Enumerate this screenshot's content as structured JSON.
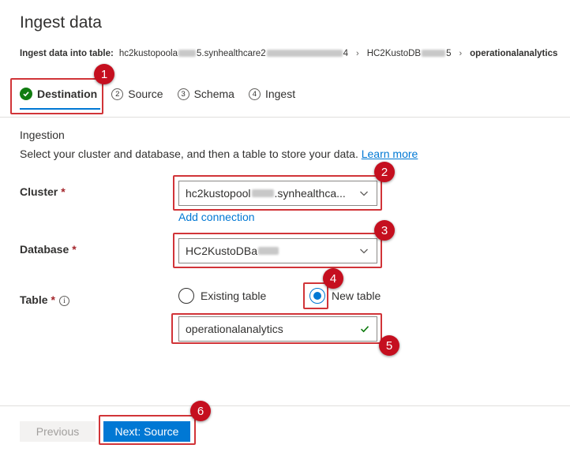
{
  "header": {
    "title": "Ingest data"
  },
  "breadcrumb": {
    "label": "Ingest data into table:",
    "cluster_prefix": "hc2kustopoola",
    "cluster_suffix": "5.synhealthcare2",
    "cluster_tail": "4",
    "database_prefix": "HC2KustoDB",
    "database_tail": "5",
    "table": "operationalanalytics"
  },
  "tabs": [
    {
      "num": "",
      "label": "Destination",
      "state": "complete"
    },
    {
      "num": "2",
      "label": "Source"
    },
    {
      "num": "3",
      "label": "Schema"
    },
    {
      "num": "4",
      "label": "Ingest"
    }
  ],
  "ingestion": {
    "title": "Ingestion",
    "description": "Select your cluster and database, and then a table to store your data.",
    "learn_more": "Learn more"
  },
  "cluster": {
    "label": "Cluster",
    "required": "*",
    "value_prefix": "hc2kustopool",
    "value_suffix": ".synhealthca...",
    "add_connection": "Add connection"
  },
  "database": {
    "label": "Database",
    "required": "*",
    "value_prefix": "HC2KustoDBa"
  },
  "table": {
    "label": "Table",
    "required": "*",
    "info": "i",
    "options": [
      "Existing table",
      "New table"
    ],
    "selected": "New table",
    "name": "operationalanalytics"
  },
  "footer": {
    "previous": "Previous",
    "next": "Next: Source"
  },
  "annotations": [
    "1",
    "2",
    "3",
    "4",
    "5",
    "6"
  ],
  "colors": {
    "accent": "#0078d4",
    "success": "#107c10",
    "annotation": "#c50f1f",
    "annotation_box": "#d13438"
  }
}
